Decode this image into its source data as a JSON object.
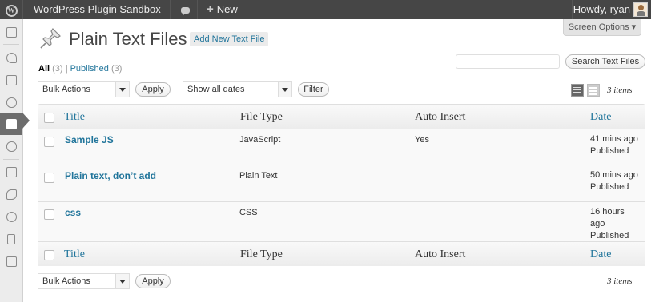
{
  "adminbar": {
    "site_name": "WordPress Plugin Sandbox",
    "new_label": "New",
    "howdy": "Howdy, ryan"
  },
  "screen_options": "Screen Options ▾",
  "page": {
    "title": "Plain Text Files",
    "add_new": "Add New Text File"
  },
  "views": {
    "all_label": "All",
    "all_count": "(3)",
    "sep": "|",
    "published_label": "Published",
    "published_count": "(3)"
  },
  "search": {
    "button": "Search Text Files"
  },
  "actions": {
    "bulk_actions": "Bulk Actions",
    "apply": "Apply",
    "dates": "Show all dates",
    "filter": "Filter",
    "items_count": "3 items"
  },
  "table": {
    "columns": [
      "Title",
      "File Type",
      "Auto Insert",
      "Date"
    ],
    "rows": [
      {
        "title": "Sample JS",
        "file_type": "JavaScript",
        "auto_insert": "Yes",
        "date_1": "41 mins ago",
        "date_2": "",
        "status": "Published"
      },
      {
        "title": "Plain text, don’t add",
        "file_type": "Plain Text",
        "auto_insert": "",
        "date_1": "50 mins ago",
        "date_2": "",
        "status": "Published"
      },
      {
        "title": "css",
        "file_type": "CSS",
        "auto_insert": "",
        "date_1": "16 hours",
        "date_2": "ago",
        "status": "Published"
      }
    ]
  },
  "colors": {
    "adminbar_bg": "#464646",
    "link": "#21759b",
    "menu_current": "#6d6d6d"
  }
}
